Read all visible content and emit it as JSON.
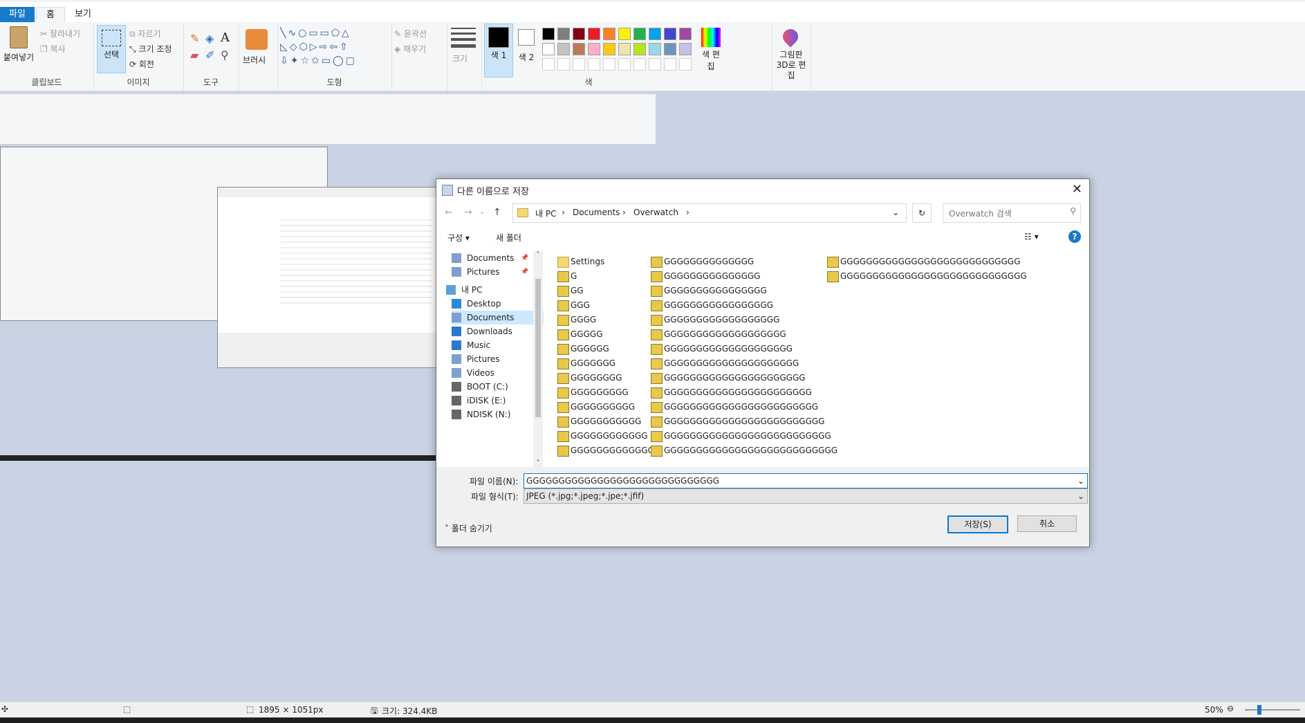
{
  "menu": {
    "file": "파일",
    "home": "홈",
    "view": "보기"
  },
  "ribbon": {
    "clipboard": {
      "label": "클립보드",
      "paste": "붙여넣기",
      "cut": "잘라내기",
      "copy": "복사"
    },
    "image": {
      "label": "이미지",
      "select": "선택",
      "crop": "자르기",
      "resize": "크기 조정",
      "rotate": "회전"
    },
    "tools": {
      "label": "도구"
    },
    "brushes": {
      "label": "브러시"
    },
    "shapes": {
      "label": "도형",
      "outline": "윤곽선",
      "fill": "채우기"
    },
    "size": {
      "label": "크기"
    },
    "colors": {
      "label": "색",
      "color1": "색 1",
      "color2": "색 2",
      "edit": "색 편집",
      "paint3d": "그림판 3D로 편집",
      "palette": [
        "#000000",
        "#7f7f7f",
        "#880015",
        "#ed1c24",
        "#ff7f27",
        "#fff200",
        "#22b14c",
        "#00a2e8",
        "#3f48cc",
        "#a349a4",
        "#ffffff",
        "#c3c3c3",
        "#b97a57",
        "#ffaec9",
        "#ffc90e",
        "#efe4b0",
        "#b5e61d",
        "#99d9ea",
        "#7092be",
        "#c8bfe7"
      ]
    }
  },
  "dialog": {
    "title": "다른 이름으로 저장",
    "breadcrumb": [
      "내 PC",
      "Documents",
      "Overwatch"
    ],
    "search_placeholder": "Overwatch 검색",
    "organize": "구성",
    "new_folder": "새 폴더",
    "nav": [
      "Documents",
      "Pictures",
      "내 PC",
      "Desktop",
      "Documents",
      "Downloads",
      "Music",
      "Pictures",
      "Videos",
      "BOOT (C:)",
      "iDISK (E:)",
      "NDISK (N:)"
    ],
    "files_col1": [
      "Settings",
      "G",
      "GG",
      "GGG",
      "GGGG",
      "GGGGG",
      "GGGGGG",
      "GGGGGGG",
      "GGGGGGGG",
      "GGGGGGGGG",
      "GGGGGGGGGG",
      "GGGGGGGGGGG",
      "GGGGGGGGGGGG",
      "GGGGGGGGGGGGG"
    ],
    "files_col2": [
      "GGGGGGGGGGGGGG",
      "GGGGGGGGGGGGGGG",
      "GGGGGGGGGGGGGGGG",
      "GGGGGGGGGGGGGGGGG",
      "GGGGGGGGGGGGGGGGGG",
      "GGGGGGGGGGGGGGGGGGG",
      "GGGGGGGGGGGGGGGGGGGG",
      "GGGGGGGGGGGGGGGGGGGGG",
      "GGGGGGGGGGGGGGGGGGGGGG",
      "GGGGGGGGGGGGGGGGGGGGGGG",
      "GGGGGGGGGGGGGGGGGGGGGGGG",
      "GGGGGGGGGGGGGGGGGGGGGGGGG",
      "GGGGGGGGGGGGGGGGGGGGGGGGGG",
      "GGGGGGGGGGGGGGGGGGGGGGGGGGG"
    ],
    "files_col3": [
      "GGGGGGGGGGGGGGGGGGGGGGGGGGGG",
      "GGGGGGGGGGGGGGGGGGGGGGGGGGGGG"
    ],
    "filename_label": "파일 이름(N):",
    "filename_value": "GGGGGGGGGGGGGGGGGGGGGGGGGGGGGG",
    "filetype_label": "파일 형식(T):",
    "filetype_value": "JPEG (*.jpg;*.jpeg;*.jpe;*.jfif)",
    "hide_folders": "폴더 숨기기",
    "save": "저장(S)",
    "cancel": "취소"
  },
  "status": {
    "dimensions": "1895 × 1051px",
    "size": "크기: 324.4KB",
    "zoom": "50%"
  }
}
